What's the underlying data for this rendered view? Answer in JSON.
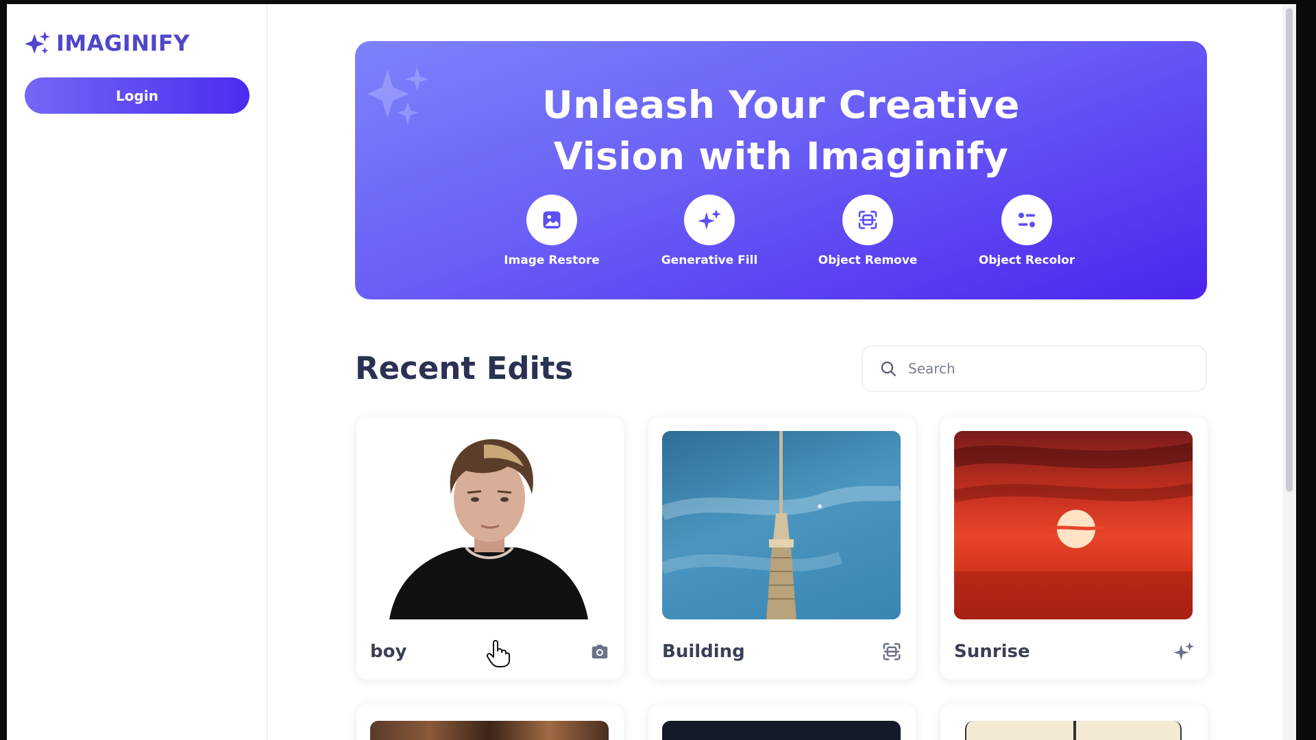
{
  "app": {
    "brand": "IMAGINIFY",
    "login_label": "Login"
  },
  "hero": {
    "title_line1": "Unleash Your Creative",
    "title_line2": "Vision with Imaginify",
    "tools": [
      {
        "label": "Image Restore",
        "icon": "image-icon"
      },
      {
        "label": "Generative Fill",
        "icon": "sparkles-icon"
      },
      {
        "label": "Object Remove",
        "icon": "scan-icon"
      },
      {
        "label": "Object Recolor",
        "icon": "filter-icon"
      }
    ]
  },
  "recent": {
    "title": "Recent Edits",
    "search_placeholder": "Search",
    "cards": [
      {
        "title": "boy",
        "type_icon": "camera-icon"
      },
      {
        "title": "Building",
        "type_icon": "scan-icon"
      },
      {
        "title": "Sunrise",
        "type_icon": "sparkles-icon"
      }
    ]
  },
  "colors": {
    "brand": "#4f46c9",
    "hero_start": "#7d82fb",
    "hero_end": "#4b25ee",
    "heading": "#2b3152"
  }
}
